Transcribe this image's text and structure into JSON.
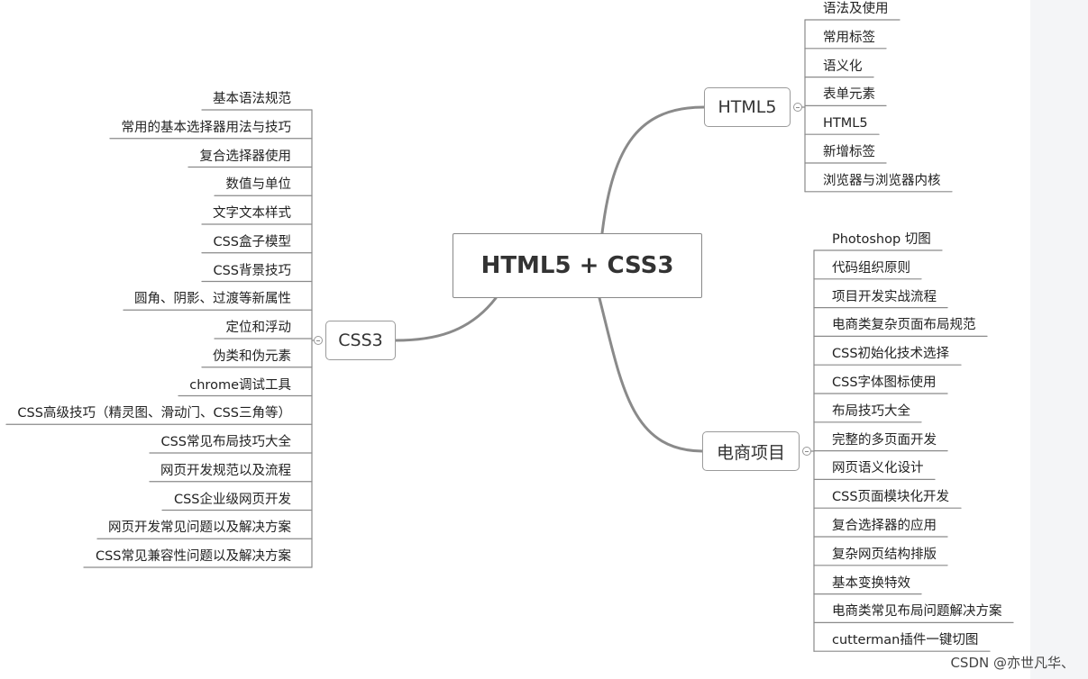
{
  "central": "HTML5 + CSS3",
  "branches": {
    "html5": {
      "label": "HTML5",
      "items": [
        "语法及使用",
        "常用标签",
        "语义化",
        "表单元素",
        "HTML5",
        "新增标签",
        "浏览器与浏览器内核"
      ]
    },
    "css3": {
      "label": "CSS3",
      "items": [
        "基本语法规范",
        "常用的基本选择器用法与技巧",
        "复合选择器使用",
        "数值与单位",
        "文字文本样式",
        "CSS盒子模型",
        "CSS背景技巧",
        "圆角、阴影、过渡等新属性",
        "定位和浮动",
        "伪类和伪元素",
        "chrome调试工具",
        "CSS高级技巧（精灵图、滑动门、CSS三角等）",
        "CSS常见布局技巧大全",
        "网页开发规范以及流程",
        "CSS企业级网页开发",
        "网页开发常见问题以及解决方案",
        "CSS常见兼容性问题以及解决方案"
      ]
    },
    "ecommerce": {
      "label": "电商项目",
      "items": [
        "Photoshop 切图",
        "代码组织原则",
        "项目开发实战流程",
        "电商类复杂页面布局规范",
        "CSS初始化技术选择",
        "CSS字体图标使用",
        "布局技巧大全",
        "完整的多页面开发",
        "网页语义化设计",
        "CSS页面模块化开发",
        "复合选择器的应用",
        "复杂网页结构排版",
        "基本变换特效",
        "电商类常见布局问题解决方案",
        "cutterman插件一键切图"
      ]
    }
  },
  "watermark": "CSDN @亦世凡华、",
  "colors": {
    "line": "#8a8a8a",
    "border": "#9a9a9a",
    "text": "#222222"
  }
}
